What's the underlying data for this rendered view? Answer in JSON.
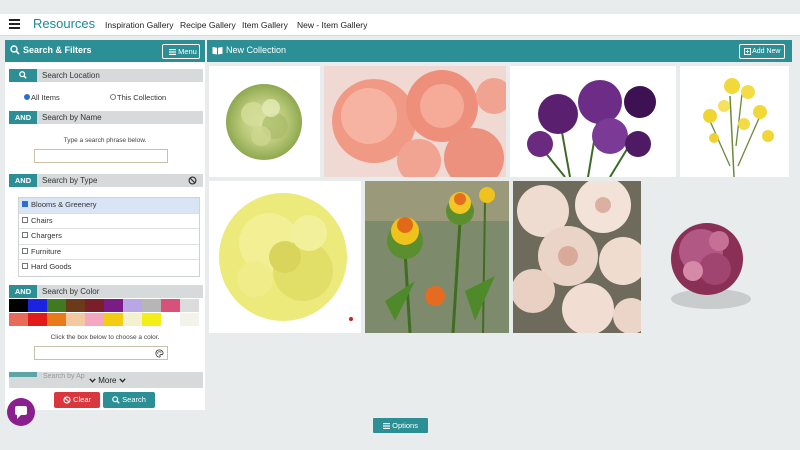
{
  "app": {
    "brand": "Resources",
    "nav": [
      "Inspiration Gallery",
      "Recipe Gallery",
      "Item Gallery",
      "New - Item Gallery"
    ]
  },
  "sidebar": {
    "title": "Search & Filters",
    "menu_label": "Menu",
    "location": {
      "label": "Search Location",
      "options": [
        "All Items",
        "This Collection"
      ],
      "selected": "All Items"
    },
    "by_name": {
      "and": "AND",
      "label": "Search by Name",
      "hint": "Type a search phrase below.",
      "value": ""
    },
    "by_type": {
      "and": "AND",
      "label": "Search by Type",
      "items": [
        "Blooms & Greenery",
        "Chairs",
        "Chargers",
        "Furniture",
        "Hard Goods"
      ],
      "checked": [
        "Blooms & Greenery"
      ]
    },
    "by_color": {
      "and": "AND",
      "label": "Search by Color",
      "hint": "Click the box below to choose a color.",
      "swatches": [
        "#000000",
        "#1a23e0",
        "#3f7a1e",
        "#6b3a1a",
        "#7a1e2a",
        "#7a1b86",
        "#b9a6e6",
        "#b6b6b6",
        "#d8517a",
        "#dcdcdc",
        "#e86a5a",
        "#e31a1a",
        "#e87a1a",
        "#f2c9a0",
        "#f5a6c0",
        "#f2cd12",
        "#f4f1d0",
        "#f4ee18",
        "#ffffff",
        "#f3f3ec"
      ],
      "value": ""
    },
    "more_label": "More",
    "ghost_label": "Search by Ap",
    "clear_label": "Clear",
    "search_label": "Search"
  },
  "collection": {
    "title": "New Collection",
    "add_label": "Add New",
    "tiles": [
      {
        "name": "green-carnation"
      },
      {
        "name": "peach-carnations"
      },
      {
        "name": "purple-carnations"
      },
      {
        "name": "yellow-spray-carnations"
      },
      {
        "name": "yellow-carnation"
      },
      {
        "name": "safflower"
      },
      {
        "name": "white-pink-carnations"
      },
      {
        "name": "burgundy-bicolor-carnation"
      }
    ]
  },
  "footer": {
    "options_label": "Options"
  }
}
